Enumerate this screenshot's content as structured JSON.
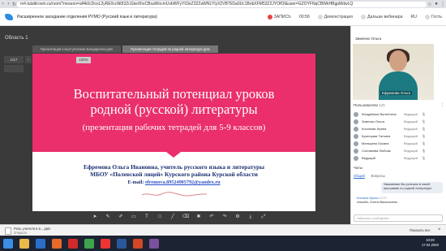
{
  "browser": {
    "url": "m4.tutalkroom.ru/room?mearoo=af4k0cDoxL2yRE0coNt53ZcGkeXhxCBsaWocmUvbWFyY03eZ32ZaWNLYIyX2VBTE5a0Uc1BobXFM53Z2JYOfOI&user=GZOYFNqCBWkHBgpMdwLQ"
  },
  "header": {
    "title": "Расширенное заседание отделения РУМО (Русский язык и литература)",
    "items": [
      "ЗАПИСЬ",
      "00:58",
      "Демонстрация",
      "Дальше вебинара",
      "RU",
      "Гость"
    ]
  },
  "left": {
    "area_label": "Область 1",
    "tabs": [
      {
        "label": "Презентация к выступлению Бондаренко.pptx",
        "active": false
      },
      {
        "label": "Презентация тетрадей по родной литературе.pptx",
        "active": true
      }
    ],
    "pager": {
      "page": "1/17",
      "zoom": "100%"
    }
  },
  "slide": {
    "title_line1": "Воспитательный потенциал уроков",
    "title_line2": "родной (русской) литературы",
    "subtitle": "(презентация рабочих тетрадей для 5-9 классов)",
    "author_line1": "Ефремова Ольга Ивановна, учитель русского языка и литературы",
    "author_line2": "МБОУ «Полевской лицей» Курского района Курской области",
    "email_label": "E-mail:",
    "email": "efremova.89524905792@yandex.ru",
    "band_color": "#ea2f6c"
  },
  "toolbar": {
    "icons": [
      "pointer-icon",
      "pen-icon",
      "pencil-icon",
      "marker-icon",
      "text-icon",
      "square-icon",
      "line-icon",
      "eraser-icon",
      "trash-icon",
      "undo-icon",
      "redo-icon",
      "settings-icon",
      "download-icon",
      "fullscreen-icon"
    ]
  },
  "video": {
    "header": "Зименко Ольга",
    "name": "Ефремова Ольга"
  },
  "participants": {
    "title": "Пользователи",
    "count": "121",
    "list": [
      {
        "name": "Жердёвина Валентина",
        "status": "Ведущий"
      },
      {
        "name": "Зименко Ольга",
        "status": "Ведущий"
      },
      {
        "name": "Косинова Ирина",
        "status": "Ведущий"
      },
      {
        "name": "Кузнецова Татьяна",
        "status": "Ведущий"
      },
      {
        "name": "Мальцева Оксана",
        "status": "Ведущий"
      },
      {
        "name": "Соловьёва Любовь",
        "status": "Ведущий"
      },
      {
        "name": "Ведущий",
        "status": "Ведущий"
      }
    ]
  },
  "chat": {
    "title": "Чаты",
    "tabs": [
      "Общий",
      "Вопросы"
    ],
    "bubble": "Уважаемые Вы успешно в своей программе по родной литературе",
    "msg_author": "Кочкина Ирина",
    "msg_time": "10:27",
    "msg_text": "спасибо, Елена Васильевна",
    "input_placeholder": "Написать сообщение"
  },
  "download": {
    "file": "Роль учителя в в....pptx",
    "sub": "Открыть",
    "show_all": "Показать все"
  },
  "clock": {
    "time": "10:29",
    "date": "17.04.2020"
  }
}
